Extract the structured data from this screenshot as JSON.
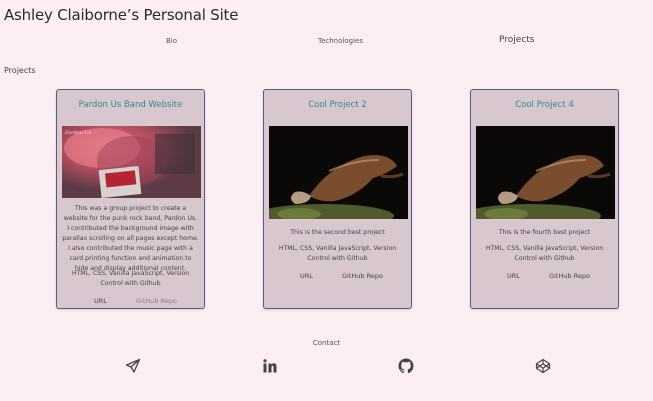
{
  "site": {
    "title": "Ashley Claiborne’s Personal Site"
  },
  "nav": {
    "bio": "Bio",
    "technologies": "Technologies",
    "projects": "Projects"
  },
  "section": {
    "label": "Projects"
  },
  "projects": [
    {
      "title": "Pardon Us Band Website",
      "image": "pardon-us-band-site-screenshot",
      "description": "This was a group project to create a website for the punk rock band, Pardon Us. I contributed the background image with parallax scrolling on all pages except home. I also contributed the music page with a card printing function and animation to hide and display additional content.",
      "tech": "HTML, CSS, Vanilla JavaScript, Version Control with Github",
      "url_label": "URL",
      "repo_label": "GitHub Repo"
    },
    {
      "title": "Cool Project 2",
      "image": "platypus-photo",
      "description": "This is the second best project",
      "tech": "HTML, CSS, Vanilla JavaScript, Version Control with Github",
      "url_label": "URL",
      "repo_label": "GitHub Repo"
    },
    {
      "title": "Cool Project 4",
      "image": "platypus-photo",
      "description": "This is the fourth best project",
      "tech": "HTML, CSS, Vanilla JavaScript, Version Control with Github",
      "url_label": "URL",
      "repo_label": "GitHub Repo"
    }
  ],
  "contact": {
    "label": "Contact",
    "icons": [
      "paper-plane-icon",
      "linkedin-icon",
      "github-icon",
      "codepen-icon"
    ]
  },
  "colors": {
    "background": "#fdeef3",
    "card": "#d9c7d0",
    "card_border": "#5d5a7a",
    "title_teal": "#2f8a8a"
  }
}
